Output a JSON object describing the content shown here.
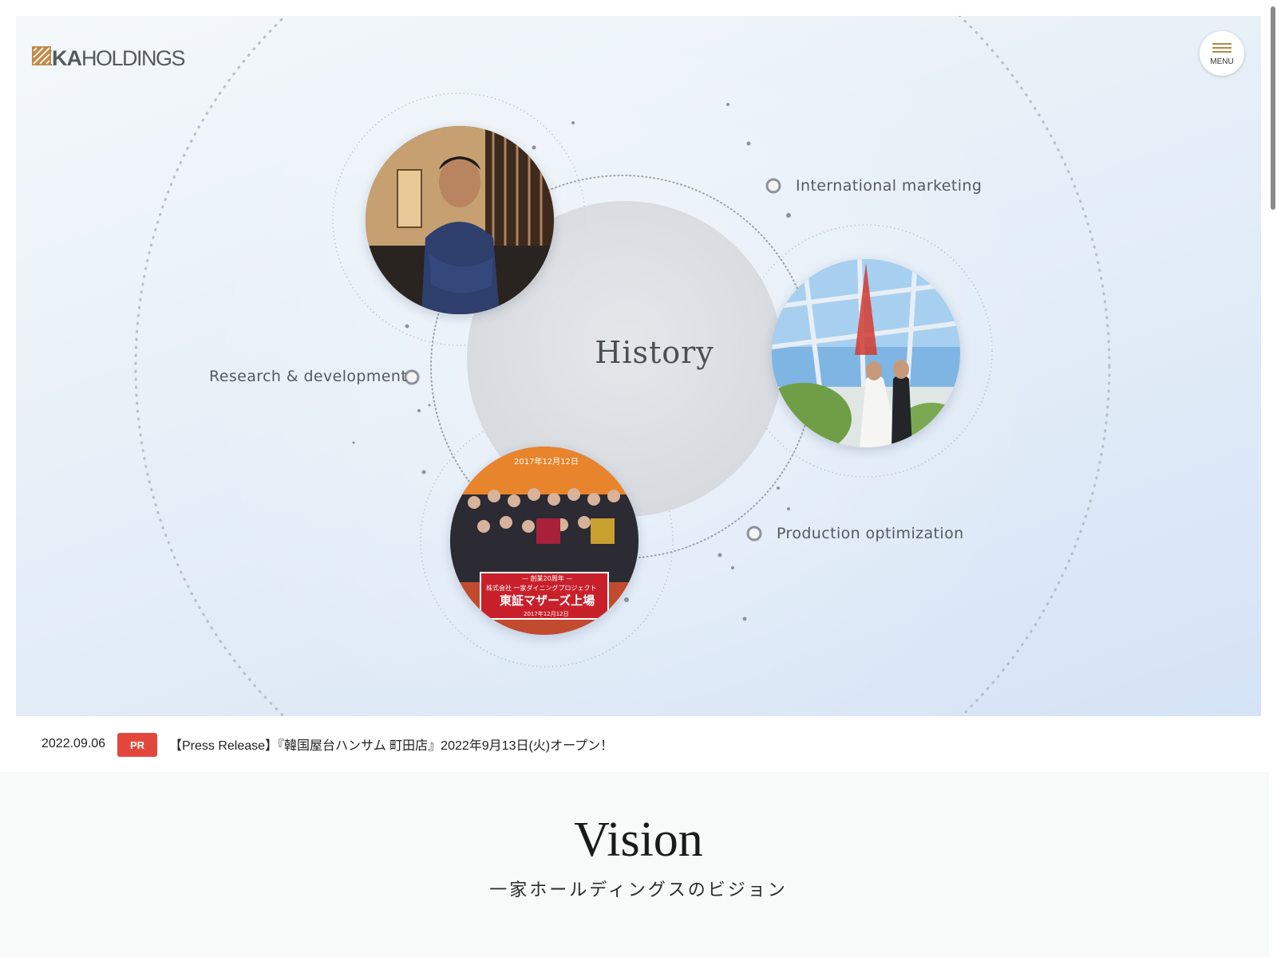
{
  "header": {
    "logo_bold": "IKKA",
    "logo_light": "HOLDINGS",
    "menu_label": "MENU"
  },
  "hero": {
    "center_title": "History",
    "nodes": [
      {
        "label": "International marketing"
      },
      {
        "label": "Research & development"
      },
      {
        "label": "Production optimization"
      }
    ],
    "photos": [
      {
        "name": "chef-portrait-photo"
      },
      {
        "name": "wedding-tower-photo"
      },
      {
        "name": "group-celebration-photo"
      }
    ],
    "banner_text": {
      "date": "2017年12月12日",
      "line1": "— 創業20周年 —",
      "line2": "株式会社 一家ダイニングプロジェクト",
      "line3": "東証マザーズ上場",
      "line4": "2017年12月12日"
    }
  },
  "news": {
    "date": "2022.09.06",
    "badge": "PR",
    "title": "【Press Release】『韓国屋台ハンサム 町田店』2022年9月13日(火)オープン！"
  },
  "vision": {
    "title": "Vision",
    "subtitle": "一家ホールディングスのビジョン"
  },
  "colors": {
    "accent": "#b88a4a",
    "badge": "#e2473c",
    "text": "#222222"
  }
}
